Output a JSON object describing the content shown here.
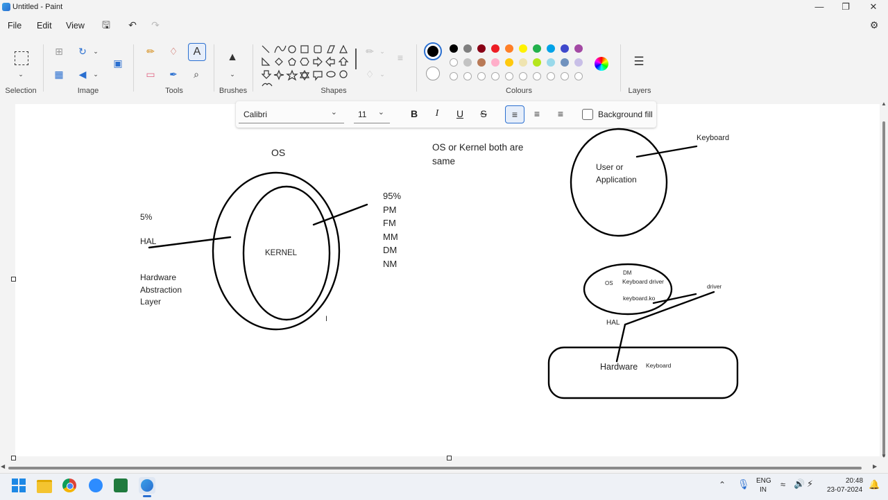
{
  "window": {
    "title": "Untitled - Paint"
  },
  "menu": {
    "file": "File",
    "edit": "Edit",
    "view": "View"
  },
  "ribbon": {
    "groups": {
      "selection": "Selection",
      "image": "Image",
      "tools": "Tools",
      "brushes": "Brushes",
      "shapes": "Shapes",
      "colours": "Colours",
      "layers": "Layers"
    },
    "colors_row1": [
      "#000000",
      "#7f7f7f",
      "#880015",
      "#ed1c24",
      "#ff7f27",
      "#fff200",
      "#22b14c",
      "#00a2e8",
      "#3f48cc",
      "#a349a4"
    ],
    "colors_row2": [
      "#ffffff",
      "#c3c3c3",
      "#b97a57",
      "#ffaec9",
      "#ffc90e",
      "#efe4b0",
      "#b5e61d",
      "#99d9ea",
      "#7092be",
      "#c8bfe7"
    ]
  },
  "textbar": {
    "font": "Calibri",
    "size": "11",
    "bold": "B",
    "italic": "I",
    "underline": "U",
    "strike": "S",
    "background_fill": "Background fill"
  },
  "canvas": {
    "os_label": "OS",
    "five_percent": "5%",
    "hal": "HAL",
    "hal_full": "Hardware\nAbstraction\nLayer",
    "kernel": "KERNEL",
    "modules": "95%\nPM\nFM\nMM\nDM\nNM",
    "os_kernel_note": "OS or Kernel both are\nsame",
    "keyboard": "Keyboard",
    "user_app": "User or\nApplication",
    "small_os": "OS",
    "small_dm": "DM",
    "keyboard_driver": "Keyboard driver",
    "keyboard_ko": "keyboard.ko",
    "driver": "driver",
    "hal_small": "HAL",
    "hardware": "Hardware",
    "hardware_keyboard": "Keyboard"
  },
  "taskbar": {
    "lang1": "ENG",
    "lang2": "IN",
    "time": "20:48",
    "date": "23-07-2024"
  }
}
